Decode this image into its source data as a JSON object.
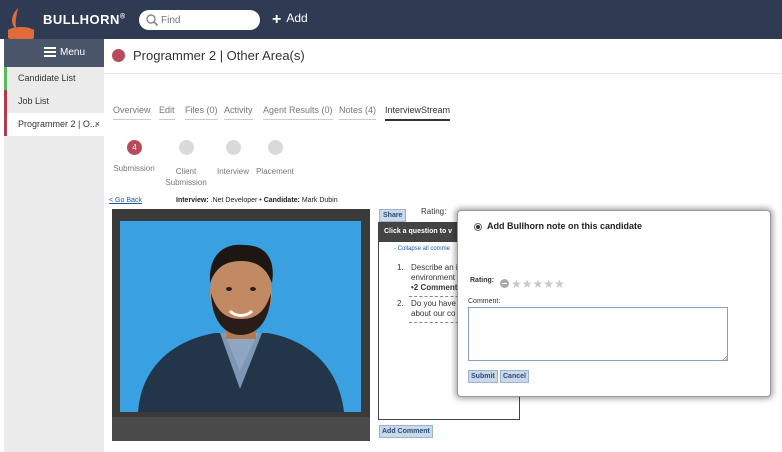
{
  "brand": {
    "name": "BULLHORN",
    "mark": "®"
  },
  "search": {
    "placeholder": "Find"
  },
  "header_actions": {
    "add_label": "Add"
  },
  "sidebar": {
    "menu_label": "Menu",
    "items": [
      {
        "label": "Candidate List"
      },
      {
        "label": "Job List"
      },
      {
        "label": "Programmer 2 | O...",
        "close": "×"
      }
    ]
  },
  "page": {
    "title": "Programmer 2 | Other Area(s)"
  },
  "tabs": [
    {
      "label": "Overview"
    },
    {
      "label": "Edit"
    },
    {
      "label": "Files (0)"
    },
    {
      "label": "Activity"
    },
    {
      "label": "Agent Results (0)"
    },
    {
      "label": "Notes (4)"
    },
    {
      "label": "InterviewStream"
    }
  ],
  "pipeline": {
    "steps": [
      {
        "count": "4",
        "label": "Submission"
      },
      {
        "label": "Client Submission"
      },
      {
        "label": "Interview"
      },
      {
        "label": "Placement"
      }
    ]
  },
  "interview": {
    "go_back": "< Go Back",
    "interview_label": "Interview:",
    "interview_value": ".Net Developer",
    "separator": "•",
    "candidate_label": "Candidate:",
    "candidate_value": "Mark Dubin",
    "share_label": "Share",
    "rating_label": "Rating:",
    "questions_header": "Click a question to v",
    "collapse_label": "- Collapse all comme",
    "questions": [
      {
        "num": "1.",
        "lines": [
          "Describe an i",
          "environment"
        ],
        "comments": "•2 Comment"
      },
      {
        "num": "2.",
        "lines": [
          "Do you have",
          "about our co"
        ]
      }
    ],
    "add_comment_label": "Add Comment"
  },
  "note_dialog": {
    "title": "Add Bullhorn note on this candidate",
    "rating_label": "Rating:",
    "comment_label": "Comment:",
    "comment_value": "",
    "submit_label": "Submit",
    "cancel_label": "Cancel"
  },
  "colors": {
    "topbar": "#2f3b52",
    "brand_orange": "#e06a3b",
    "accent_red": "#b74a5c",
    "video_bg": "#39a0e2"
  },
  "icons": {
    "logo": "bull-logo-icon",
    "search": "search-icon",
    "add": "plus-icon",
    "menu": "hamburger-icon",
    "record": "record-dot-icon"
  }
}
